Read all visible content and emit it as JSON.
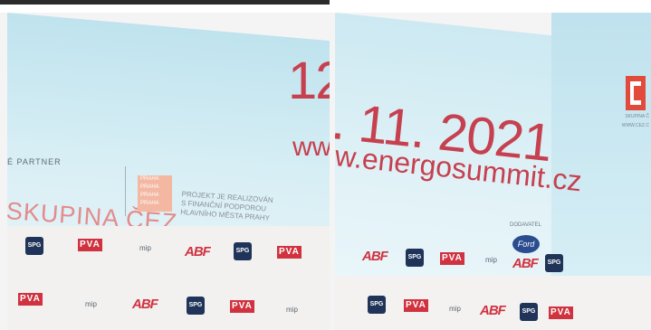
{
  "photo_left": {
    "date": "12",
    "url": "www",
    "partner_label": "É PARTNER",
    "brand": "SKUPINA ČEZ",
    "praha_block": [
      "PRAHA",
      "PRAHA",
      "PRAHA",
      "PRAHA"
    ],
    "project_lines": [
      "PROJEKT JE REALIZOVÁN",
      "S FINANČNÍ PODPOROU",
      "HLAVNÍHO MĚSTA PRAHY"
    ],
    "backdrop_row1": [
      "SPG",
      "PVA",
      "mip",
      "ABF",
      "SPG",
      "PVA"
    ],
    "backdrop_row2": [
      "PVA",
      "mip",
      "ABF",
      "SPG",
      "PVA",
      "mip"
    ]
  },
  "photo_right": {
    "date": ". 11. 2021",
    "url": "w.energosummit.cz",
    "ceo_text1": "SKUPINA Č",
    "ceo_text2": "WWW.CEZ.C",
    "ford_label": "DODAVATEL",
    "ford_brand": "Ford",
    "backdrop_row1": [
      "ABF",
      "SPG",
      "PVA",
      "mip",
      "ABF",
      "SPG"
    ],
    "backdrop_row2": [
      "SPG",
      "PVA",
      "mip",
      "ABF",
      "SPG",
      "PVA"
    ]
  },
  "colors": {
    "accent_red": "#c6404f",
    "screen_blue": "#cde9f2",
    "logo_navy": "#1f3458"
  }
}
